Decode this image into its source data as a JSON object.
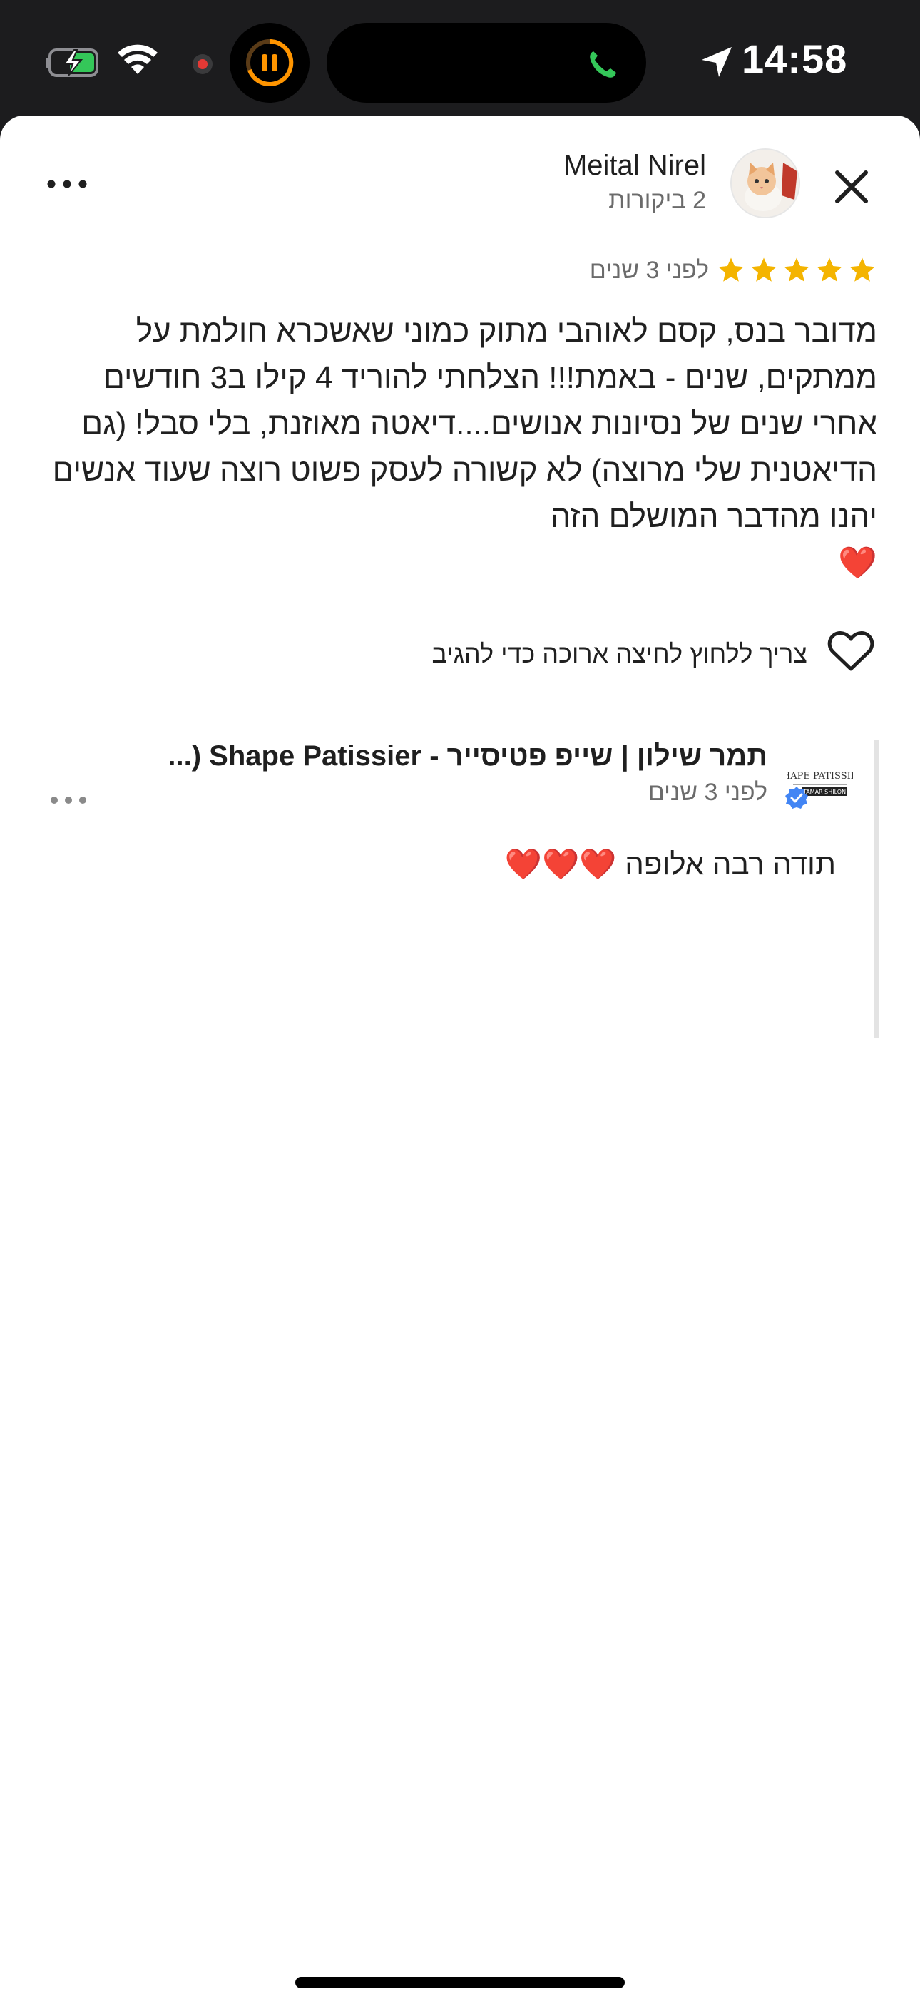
{
  "status_bar": {
    "time": "14:58",
    "icons": [
      "battery-charging-icon",
      "wifi-icon",
      "recording-dot-icon",
      "pause-icon",
      "phone-call-icon",
      "location-arrow-icon"
    ]
  },
  "review": {
    "reviewer_name": "Meital Nirel",
    "reviewer_meta": "2 ביקורות",
    "rating": 5,
    "date": "לפני 3 שנים",
    "text": "מדובר בנס, קסם לאוהבי מתוק כמוני שאשכרא חולמת על ממתקים, שנים - באמת!!! הצלחתי להוריד 4 קילו ב3 חודשים אחרי שנים של נסיונות אנושים....דיאטה מאוזנת, בלי סבל! (גם הדיאטנית שלי מרוצה) לא קשורה לעסק פשוט רוצה שעוד אנשים יהנו מהדבר המושלם הזה\n❤️",
    "like_prompt": "צריך ללחוץ לחיצה ארוכה כדי להגיב"
  },
  "owner_reply": {
    "name": "תמר שילון | שייפ פטיסייר - Shape Patissier (...",
    "date": "לפני 3 שנים",
    "text": "תודה רבה אלופה ❤️❤️❤️",
    "logo_text_top": "SHAPE PATISSIER",
    "logo_text_bottom": "TAMAR SHILON"
  },
  "colors": {
    "star": "#f4b400",
    "verified": "#4285f4",
    "status_bg": "#1c1c1e",
    "call_green": "#34c759"
  }
}
